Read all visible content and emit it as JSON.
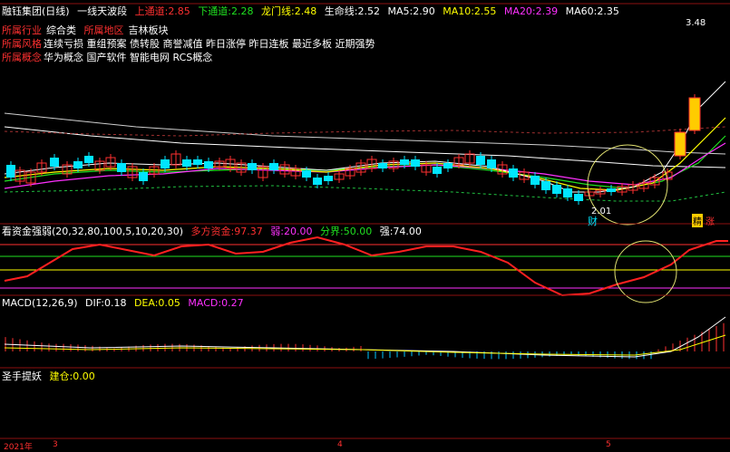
{
  "header": {
    "stock_name": "融钰集团(日线)",
    "indicator_name": "一线天波段",
    "upper_label": "上通道:",
    "upper_value": "2.85",
    "lower_label": "下通道:",
    "lower_value": "2.28",
    "dragon_label": "龙门线:",
    "dragon_value": "2.48",
    "life_label": "生命线:",
    "life_value": "2.52",
    "ma5_label": "MA5:",
    "ma5_value": "2.90",
    "ma10_label": "MA10:",
    "ma10_value": "2.55",
    "ma20_label": "MA20:",
    "ma20_value": "2.39",
    "ma60_label": "MA60:",
    "ma60_value": "2.35"
  },
  "info": {
    "industry_label": "所属行业",
    "industry_value": "综合类",
    "region_label": "所属地区",
    "region_value": "吉林板块",
    "style_label": "所属风格",
    "style_value": "连续亏损 重组预案 债转股 商誉减值 昨日涨停 昨日连板 最近多板 近期强势",
    "concept_label": "所属概念",
    "concept_value": "华为概念 国产软件 智能电网 RCS概念"
  },
  "price_panel": {
    "high_mark": "3.48",
    "low_mark": "2.01",
    "cai_label": "财",
    "tag_jing": "精",
    "tag_zhang": "涨"
  },
  "strength_panel": {
    "title": "看资金强弱(20,32,80,100,5,10,20,30)",
    "duofang_label": "多方资金:",
    "duofang_value": "97.37",
    "ruo_label": "弱:",
    "ruo_value": "20.00",
    "fenjie_label": "分界:",
    "fenjie_value": "50.00",
    "qiang_label": "强:",
    "qiang_value": "74.00"
  },
  "macd_panel": {
    "title": "MACD(12,26,9)",
    "dif_label": "DIF:",
    "dif_value": "0.18",
    "dea_label": "DEA:",
    "dea_value": "0.05",
    "macd_label": "MACD:",
    "macd_value": "0.27"
  },
  "bottom_panel": {
    "title": "圣手提妖",
    "jiancang_label": "建仓:",
    "jiancang_value": "0.00"
  },
  "date_axis": {
    "start": "2021年",
    "month1": "3",
    "month2": "4",
    "month3": "5"
  },
  "colors": {
    "up": "#ff3030",
    "down": "#00e5ff",
    "separator": "#8b1010",
    "ma5": "#ffffff",
    "ma10": "#ffff00",
    "ma20": "#ff30ff",
    "ma60": "#20e020"
  }
}
